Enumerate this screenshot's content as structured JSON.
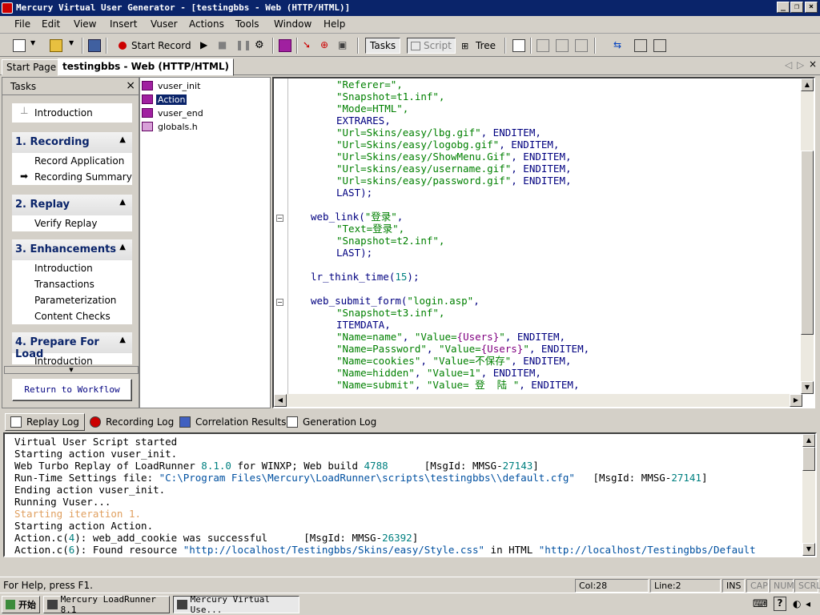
{
  "window": {
    "title": "Mercury Virtual User Generator - [testingbbs - Web (HTTP/HTML)]"
  },
  "menu": {
    "file": "File",
    "edit": "Edit",
    "view": "View",
    "insert": "Insert",
    "vuser": "Vuser",
    "actions": "Actions",
    "tools": "Tools",
    "window": "Window",
    "help": "Help"
  },
  "toolbar": {
    "start_record": "Start Record",
    "tasks": "Tasks",
    "script": "Script",
    "tree": "Tree"
  },
  "doc_tabs": {
    "start_page": "Start Page",
    "active": "testingbbs - Web (HTTP/HTML)"
  },
  "tasks": {
    "title": "Tasks",
    "intro": "Introduction",
    "s1": "1. Recording",
    "s1_i1": "Record Application",
    "s1_i2": "Recording Summary",
    "s2": "2. Replay",
    "s2_i1": "Verify Replay",
    "s3": "3. Enhancements",
    "s3_i1": "Introduction",
    "s3_i2": "Transactions",
    "s3_i3": "Parameterization",
    "s3_i4": "Content Checks",
    "s4": "4. Prepare For Load",
    "s4_i1": "Introduction",
    "return": "Return to Workflow"
  },
  "tree": {
    "n1": "vuser_init",
    "n2": "Action",
    "n3": "vuser_end",
    "n4": "globals.h"
  },
  "code": {
    "l1": "\"Referer=\",",
    "l2": "\"Snapshot=t1.inf\",",
    "l3": "\"Mode=HTML\",",
    "l4": "EXTRARES,",
    "l5a": "\"Url=Skins/easy/lbg.gif\"",
    "l5b": ", ENDITEM,",
    "l6a": "\"Url=Skins/easy/logobg.gif\"",
    "l6b": ", ENDITEM,",
    "l7a": "\"Url=Skins/easy/ShowMenu.Gif\"",
    "l7b": ", ENDITEM,",
    "l8a": "\"Url=skins/easy/username.gif\"",
    "l8b": ", ENDITEM,",
    "l9a": "\"Url=skins/easy/password.gif\"",
    "l9b": ", ENDITEM,",
    "l10": "LAST);",
    "l11a": "web_link(",
    "l11b": "\"登录\"",
    "l11c": ",",
    "l12": "\"Text=登录\",",
    "l13": "\"Snapshot=t2.inf\",",
    "l14": "LAST);",
    "l15a": "lr_think_time(",
    "l15b": "15",
    "l15c": ");",
    "l16a": "web_submit_form(",
    "l16b": "\"login.asp\"",
    "l16c": ",",
    "l17": "\"Snapshot=t3.inf\",",
    "l18": "ITEMDATA,",
    "l19a": "\"Name=name\"",
    "l19b": ", ",
    "l19c": "\"Value=",
    "l19d": "{Users}",
    "l19e": "\"",
    "l19f": ", ENDITEM,",
    "l20a": "\"Name=Password\"",
    "l20b": ", ",
    "l20c": "\"Value=",
    "l20d": "{Users}",
    "l20e": "\"",
    "l20f": ", ENDITEM,",
    "l21a": "\"Name=cookies\"",
    "l21b": ", ",
    "l21c": "\"Value=不保存\"",
    "l21d": ", ENDITEM,",
    "l22a": "\"Name=hidden\"",
    "l22b": ", ",
    "l22c": "\"Value=1\"",
    "l22d": ", ENDITEM,",
    "l23a": "\"Name=submit\"",
    "l23b": ", ",
    "l23c": "\"Value= 登  陆 \"",
    "l23d": ", ENDITEM,"
  },
  "log_tabs": {
    "t1": "Replay Log",
    "t2": "Recording Log",
    "t3": "Correlation Results",
    "t4": "Generation Log"
  },
  "log": {
    "l1": "Virtual User Script started",
    "l2": "Starting action vuser_init.",
    "l3a": "Web Turbo Replay of LoadRunner ",
    "l3b": "8.1.0",
    "l3c": " for WINXP; Web build ",
    "l3d": "4788",
    "l3e": "      [MsgId: MMSG-",
    "l3f": "27143",
    "l3g": "]",
    "l4a": "Run-Time Settings file: ",
    "l4b": "\"C:\\Program Files\\Mercury\\LoadRunner\\scripts\\testingbbs\\\\default.cfg\"",
    "l4c": "   [MsgId: MMSG-",
    "l4d": "27141",
    "l4e": "]",
    "l5": "Ending action vuser_init.",
    "l6": "Running Vuser...",
    "l7": "Starting iteration 1.",
    "l8": "Starting action Action.",
    "l9a": "Action.c(",
    "l9b": "4",
    "l9c": "): web_add_cookie was successful      [MsgId: MMSG-",
    "l9d": "26392",
    "l9e": "]",
    "l10a": "Action.c(",
    "l10b": "6",
    "l10c": "): Found resource ",
    "l10d": "\"http://localhost/Testingbbs/Skins/easy/Style.css\"",
    "l10e": " in HTML ",
    "l10f": "\"http://localhost/Testingbbs/Default"
  },
  "status": {
    "help": "For Help, press F1.",
    "col": "Col:28",
    "line": "Line:2",
    "ins": "INS",
    "cap": "CAP",
    "num": "NUM",
    "scrl": "SCRL"
  },
  "taskbar": {
    "start": "开始",
    "b1": "Mercury LoadRunner 8.1",
    "b2": "Mercury Virtual Use..."
  }
}
